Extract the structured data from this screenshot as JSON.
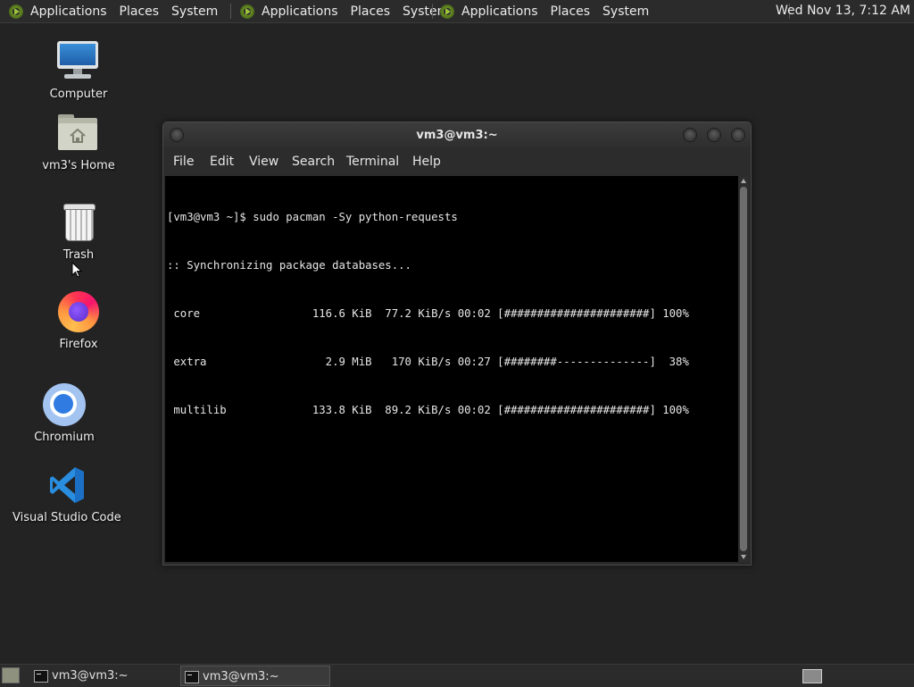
{
  "top_panel": {
    "groups": [
      {
        "applications": "Applications",
        "places": "Places",
        "system": "System"
      },
      {
        "applications": "Applications",
        "places": "Places",
        "system": "System"
      },
      {
        "applications": "Applications",
        "places": "Places",
        "system": "System"
      }
    ],
    "clock": "Wed Nov 13,  7:12 AM"
  },
  "desktop": {
    "icons": [
      {
        "label": "Computer",
        "icon": "computer-icon"
      },
      {
        "label": "vm3's Home",
        "icon": "home-folder-icon"
      },
      {
        "label": "Trash",
        "icon": "trash-icon"
      },
      {
        "label": "Firefox",
        "icon": "firefox-icon"
      },
      {
        "label": "Chromium",
        "icon": "chromium-icon"
      },
      {
        "label": "Visual Studio Code",
        "icon": "vscode-icon"
      }
    ]
  },
  "terminal": {
    "title": "vm3@vm3:~",
    "menu": [
      "File",
      "Edit",
      "View",
      "Search",
      "Terminal",
      "Help"
    ],
    "lines": [
      "[vm3@vm3 ~]$ sudo pacman -Sy python-requests",
      ":: Synchronizing package databases...",
      " core                 116.6 KiB  77.2 KiB/s 00:02 [######################] 100%",
      " extra                  2.9 MiB   170 KiB/s 00:27 [########--------------]  38%",
      " multilib             133.8 KiB  89.2 KiB/s 00:02 [######################] 100%"
    ],
    "colors": {
      "background": "#000000",
      "foreground": "#e6e6e6"
    }
  },
  "bottom_panel": {
    "tasks": [
      {
        "label": "vm3@vm3:~",
        "active": false
      },
      {
        "label": "vm3@vm3:~",
        "active": true
      }
    ]
  },
  "colors": {
    "desktop": "#232323",
    "panel": "#2b2b2b",
    "accent": "#6b8e23"
  }
}
